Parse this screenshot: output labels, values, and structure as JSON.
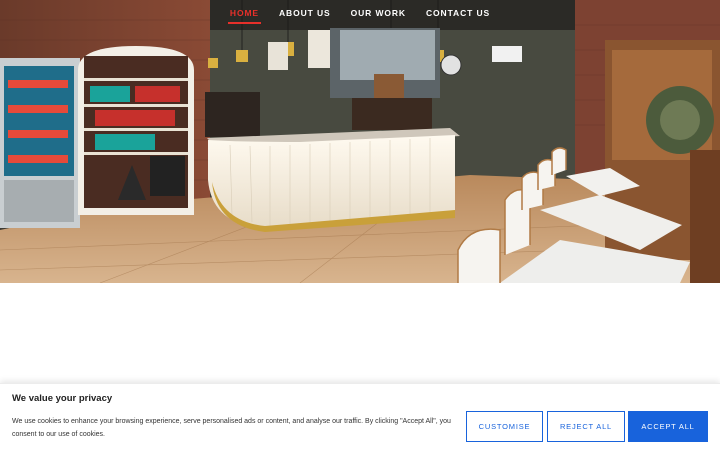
{
  "nav": {
    "items": [
      {
        "label": "HOME",
        "active": true
      },
      {
        "label": "ABOUT US",
        "active": false
      },
      {
        "label": "OUR WORK",
        "active": false
      },
      {
        "label": "CONTACT US",
        "active": false
      }
    ]
  },
  "cookie": {
    "title": "We value your privacy",
    "text": "We use cookies to enhance your browsing experience, serve personalised ads or content, and analyse our traffic. By clicking \"Accept All\", you consent to our use of cookies.",
    "customise_label": "CUSTOMISE",
    "reject_label": "REJECT ALL",
    "accept_label": "ACCEPT ALL"
  },
  "colors": {
    "nav_active": "#e8302a",
    "cookie_accent": "#1863dc"
  }
}
